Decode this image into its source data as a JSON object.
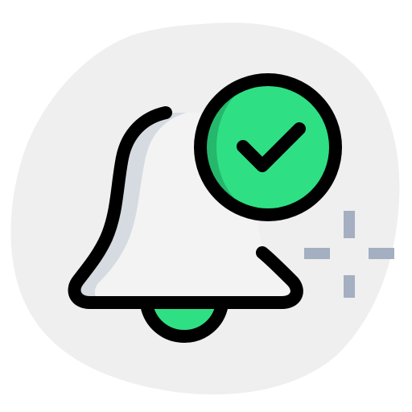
{
  "icon": {
    "name": "notification-bell-check-icon",
    "colors": {
      "background_blob": "#efefef",
      "bell_fill": "#f3f3f3",
      "bell_shadow": "#d5dbe1",
      "outline": "#000000",
      "accent_green": "#2fdf84",
      "accent_green_dark": "#25b86c",
      "sparkle": "#a4afc1"
    },
    "parts": [
      "background-blob",
      "bell",
      "bell-clapper",
      "check-badge",
      "check-mark",
      "sparkle"
    ]
  }
}
